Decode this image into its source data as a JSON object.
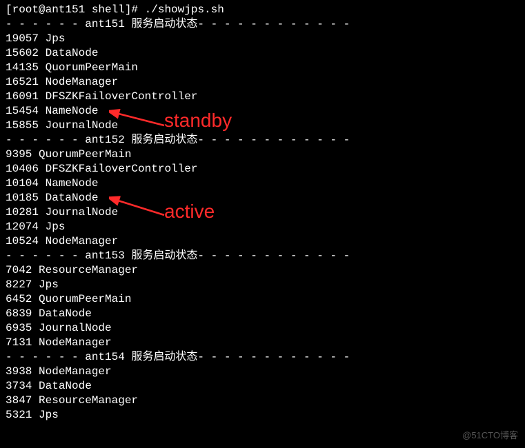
{
  "prompt": {
    "user": "root",
    "host": "ant151",
    "cwd": "shell",
    "command": "./showjps.sh"
  },
  "sections": [
    {
      "host": "ant151",
      "status_label": "服务启动状态",
      "processes": [
        {
          "pid": "19057",
          "name": "Jps"
        },
        {
          "pid": "15602",
          "name": "DataNode"
        },
        {
          "pid": "14135",
          "name": "QuorumPeerMain"
        },
        {
          "pid": "16521",
          "name": "NodeManager"
        },
        {
          "pid": "16091",
          "name": "DFSZKFailoverController"
        },
        {
          "pid": "15454",
          "name": "NameNode"
        },
        {
          "pid": "15855",
          "name": "JournalNode"
        }
      ]
    },
    {
      "host": "ant152",
      "status_label": "服务启动状态",
      "processes": [
        {
          "pid": "9395",
          "name": "QuorumPeerMain"
        },
        {
          "pid": "10406",
          "name": "DFSZKFailoverController"
        },
        {
          "pid": "10104",
          "name": "NameNode"
        },
        {
          "pid": "10185",
          "name": "DataNode"
        },
        {
          "pid": "10281",
          "name": "JournalNode"
        },
        {
          "pid": "12074",
          "name": "Jps"
        },
        {
          "pid": "10524",
          "name": "NodeManager"
        }
      ]
    },
    {
      "host": "ant153",
      "status_label": "服务启动状态",
      "processes": [
        {
          "pid": "7042",
          "name": "ResourceManager"
        },
        {
          "pid": "8227",
          "name": "Jps"
        },
        {
          "pid": "6452",
          "name": "QuorumPeerMain"
        },
        {
          "pid": "6839",
          "name": "DataNode"
        },
        {
          "pid": "6935",
          "name": "JournalNode"
        },
        {
          "pid": "7131",
          "name": "NodeManager"
        }
      ]
    },
    {
      "host": "ant154",
      "status_label": "服务启动状态",
      "processes": [
        {
          "pid": "3938",
          "name": "NodeManager"
        },
        {
          "pid": "3734",
          "name": "DataNode"
        },
        {
          "pid": "3847",
          "name": "ResourceManager"
        },
        {
          "pid": "5321",
          "name": "Jps"
        }
      ]
    }
  ],
  "dashes_left": "- - - - - - ",
  "dashes_right": "- - - - - - - - - - - - ",
  "annotations": {
    "standby": "standby",
    "active": "active"
  },
  "watermark": "@51CTO博客"
}
